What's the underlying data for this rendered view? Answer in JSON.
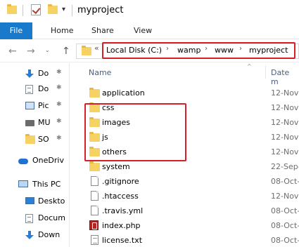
{
  "window": {
    "title": "myproject",
    "qat_dropdown_glyph": "▾"
  },
  "ribbon": {
    "tabs": [
      {
        "label": "File"
      },
      {
        "label": "Home"
      },
      {
        "label": "Share"
      },
      {
        "label": "View"
      }
    ]
  },
  "navigation": {
    "back_glyph": "←",
    "forward_glyph": "→",
    "recent_glyph": "⌄",
    "up_glyph": "↑",
    "overflow_glyph": "«",
    "breadcrumb": [
      {
        "label": "Local Disk (C:)"
      },
      {
        "label": "wamp"
      },
      {
        "label": "www"
      },
      {
        "label": "myproject"
      }
    ],
    "separator": "›"
  },
  "nav_pane": {
    "pin_glyph": "✱",
    "items": [
      {
        "label": "Do",
        "icon": "download-icon",
        "pinned": true
      },
      {
        "label": "Do",
        "icon": "document-icon",
        "pinned": true
      },
      {
        "label": "Pic",
        "icon": "pictures-icon",
        "pinned": true
      },
      {
        "label": "MU",
        "icon": "music-icon",
        "pinned": true
      },
      {
        "label": "SO",
        "icon": "folder-icon",
        "pinned": true
      },
      {
        "label": "OneDriv",
        "icon": "onedrive-icon",
        "pinned": false
      },
      {
        "label": "This PC",
        "icon": "this-pc-icon",
        "pinned": false
      },
      {
        "label": "Deskto",
        "icon": "desktop-icon",
        "pinned": false
      },
      {
        "label": "Docum",
        "icon": "document-icon",
        "pinned": false
      },
      {
        "label": "Down",
        "icon": "download-icon",
        "pinned": false
      }
    ]
  },
  "file_list": {
    "columns": {
      "name": "Name",
      "date": "Date m"
    },
    "sort_glyph": "^",
    "rows": [
      {
        "name": "application",
        "date": "12-Nov",
        "type": "folder"
      },
      {
        "name": "css",
        "date": "12-Nov",
        "type": "folder"
      },
      {
        "name": "images",
        "date": "12-Nov",
        "type": "folder"
      },
      {
        "name": "js",
        "date": "12-Nov",
        "type": "folder"
      },
      {
        "name": "others",
        "date": "12-Nov",
        "type": "folder"
      },
      {
        "name": "system",
        "date": "22-Sep-",
        "type": "folder"
      },
      {
        "name": ".gitignore",
        "date": "08-Oct-",
        "type": "file"
      },
      {
        "name": ".htaccess",
        "date": "12-Nov",
        "type": "file"
      },
      {
        "name": ".travis.yml",
        "date": "08-Oct-",
        "type": "file"
      },
      {
        "name": "index.php",
        "date": "08-Oct-",
        "type": "php"
      },
      {
        "name": "license.txt",
        "date": "08-Oct-",
        "type": "txt"
      }
    ]
  },
  "colors": {
    "file_tab": "#1979ca",
    "highlight": "#d4202a",
    "folder": "#f6d164"
  }
}
